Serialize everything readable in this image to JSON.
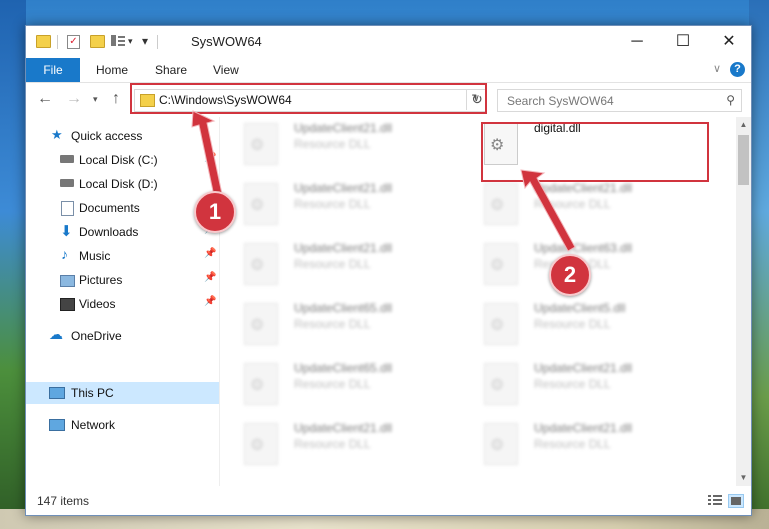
{
  "window": {
    "title": "SysWOW64"
  },
  "ribbon": {
    "tabs": [
      "File",
      "Home",
      "Share",
      "View"
    ],
    "help": "?"
  },
  "address": {
    "path": "C:\\Windows\\SysWOW64",
    "search_placeholder": "Search SysWOW64"
  },
  "nav": {
    "quick_access": "Quick access",
    "items": [
      {
        "label": "Local Disk (C:)",
        "icon": "drive-icon",
        "pinned": true
      },
      {
        "label": "Local Disk (D:)",
        "icon": "drive-icon",
        "pinned": false
      },
      {
        "label": "Documents",
        "icon": "documents-icon",
        "pinned": true
      },
      {
        "label": "Downloads",
        "icon": "download-icon",
        "pinned": true
      },
      {
        "label": "Music",
        "icon": "music-icon",
        "pinned": true
      },
      {
        "label": "Pictures",
        "icon": "pictures-icon",
        "pinned": true
      },
      {
        "label": "Videos",
        "icon": "videos-icon",
        "pinned": true
      }
    ],
    "onedrive": "OneDrive",
    "this_pc": "This PC",
    "network": "Network"
  },
  "files": [
    {
      "name": "UpdateClient21.dll",
      "type": "Resource DLL",
      "blurred": true
    },
    {
      "name": "digital.dll",
      "type": "",
      "blurred": false
    },
    {
      "name": "UpdateClient21.dll",
      "type": "Resource DLL",
      "blurred": true
    },
    {
      "name": "UpdateClient21.dll",
      "type": "Resource DLL",
      "blurred": true
    },
    {
      "name": "UpdateClient21.dll",
      "type": "Resource DLL",
      "blurred": true
    },
    {
      "name": "UpdateClient63.dll",
      "type": "Resource DLL",
      "blurred": true
    },
    {
      "name": "UpdateClient65.dll",
      "type": "Resource DLL",
      "blurred": true
    },
    {
      "name": "UpdateClient5.dll",
      "type": "Resource DLL",
      "blurred": true
    },
    {
      "name": "UpdateClient65.dll",
      "type": "Resource DLL",
      "blurred": true
    },
    {
      "name": "UpdateClient21.dll",
      "type": "Resource DLL",
      "blurred": true
    },
    {
      "name": "UpdateClient21.dll",
      "type": "Resource DLL",
      "blurred": true
    },
    {
      "name": "UpdateClient21.dll",
      "type": "Resource DLL",
      "blurred": true
    }
  ],
  "status": {
    "count": "147 items"
  },
  "annotations": {
    "step1": "1",
    "step2": "2",
    "color": "#d1343e"
  }
}
